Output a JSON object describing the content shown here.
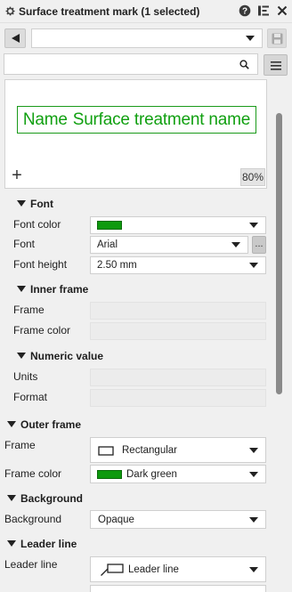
{
  "window": {
    "title": "Surface treatment mark (1 selected)"
  },
  "toolbar": {
    "style_value": "",
    "search_value": "",
    "search_placeholder": ""
  },
  "preview": {
    "label_name": "Name",
    "label_value": "Surface treatment name",
    "zoom": "80%",
    "add_symbol": "+"
  },
  "sections": {
    "font": {
      "title": "Font",
      "color_label": "Font color",
      "font_label": "Font",
      "font_value": "Arial",
      "more_label": "...",
      "height_label": "Font height",
      "height_value": "2.50 mm"
    },
    "inner_frame": {
      "title": "Inner frame",
      "frame_label": "Frame",
      "color_label": "Frame color"
    },
    "numeric_value": {
      "title": "Numeric value",
      "units_label": "Units",
      "format_label": "Format"
    },
    "outer_frame": {
      "title": "Outer frame",
      "frame_label": "Frame",
      "frame_value": "Rectangular",
      "color_label": "Frame color",
      "color_value": "Dark green"
    },
    "background": {
      "title": "Background",
      "label": "Background",
      "value": "Opaque"
    },
    "leader_line": {
      "title": "Leader line",
      "label": "Leader line",
      "value": "Leader line"
    }
  },
  "colors": {
    "mark_green": "#11a011",
    "swatch_green": "#0e9a0e"
  }
}
